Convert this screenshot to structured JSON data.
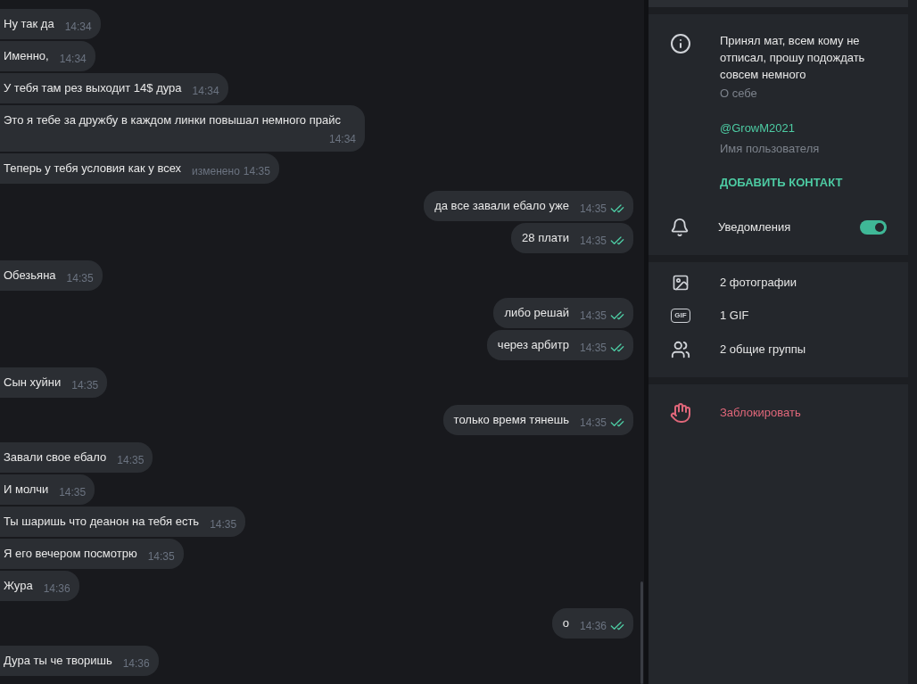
{
  "chat": {
    "groups": [
      {
        "outgoing": false,
        "messages": [
          {
            "text": "Ну так да",
            "time": "14:34"
          },
          {
            "text": "Именно,",
            "time": "14:34"
          },
          {
            "text": "У тебя там рез выходит 14$ дура",
            "time": "14:34"
          },
          {
            "text": "Это я тебе за дружбу в каждом линки повышал немного прайс",
            "time": "14:34"
          },
          {
            "text": "Теперь у тебя условия как у всех",
            "time": "14:35",
            "edited": "изменено"
          }
        ]
      },
      {
        "outgoing": true,
        "messages": [
          {
            "text": "да все завали ебало уже",
            "time": "14:35",
            "read": true
          },
          {
            "text": "28 плати",
            "time": "14:35",
            "read": true
          }
        ]
      },
      {
        "outgoing": false,
        "messages": [
          {
            "text": "Обезьяна",
            "time": "14:35"
          }
        ]
      },
      {
        "outgoing": true,
        "messages": [
          {
            "text": "либо решай",
            "time": "14:35",
            "read": true
          },
          {
            "text": "через арбитр",
            "time": "14:35",
            "read": true
          }
        ]
      },
      {
        "outgoing": false,
        "messages": [
          {
            "text": "Сын хуйни",
            "time": "14:35"
          }
        ]
      },
      {
        "outgoing": true,
        "messages": [
          {
            "text": "только время тянешь",
            "time": "14:35",
            "read": true
          }
        ]
      },
      {
        "outgoing": false,
        "messages": [
          {
            "text": "Завали свое ебало",
            "time": "14:35"
          },
          {
            "text": "И молчи",
            "time": "14:35"
          },
          {
            "text": "Ты шаришь что деанон на тебя есть",
            "time": "14:35"
          },
          {
            "text": "Я его вечером посмотрю",
            "time": "14:35"
          },
          {
            "text": "Жура",
            "time": "14:36"
          }
        ]
      },
      {
        "outgoing": true,
        "messages": [
          {
            "text": "о",
            "time": "14:36",
            "read": true
          }
        ]
      },
      {
        "outgoing": false,
        "messages": [
          {
            "text": "Дура ты че творишь",
            "time": "14:36"
          }
        ]
      }
    ]
  },
  "profile": {
    "bio": {
      "text": "Принял мат, всем кому не отписал, прошу подождать совсем немного",
      "label": "О себе"
    },
    "username": {
      "text": "@GrowM2021",
      "label": "Имя пользователя"
    },
    "add_contact": "ДОБАВИТЬ КОНТАКТ",
    "notifications": {
      "label": "Уведомления",
      "on": true
    },
    "media": [
      {
        "kind": "photos",
        "label": "2 фотографии"
      },
      {
        "kind": "gif",
        "icon_text": "GIF",
        "label": "1 GIF"
      },
      {
        "kind": "groups",
        "label": "2 общие группы"
      }
    ],
    "block": "Заблокировать"
  }
}
